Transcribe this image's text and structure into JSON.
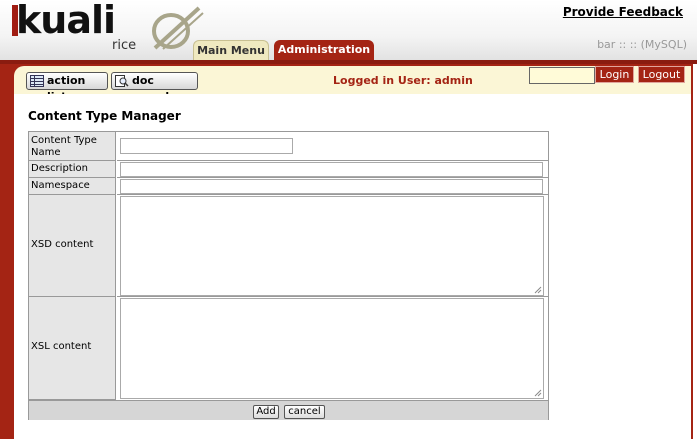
{
  "brand": {
    "name": "kuali",
    "sub": "rice"
  },
  "header": {
    "feedback": "Provide Feedback",
    "db_info": "bar :: :: (MySQL)"
  },
  "tabs": [
    {
      "label": "Main Menu",
      "active": false
    },
    {
      "label": "Administration",
      "active": true
    }
  ],
  "toolbar": {
    "action_list": "action list",
    "doc_search": "doc search"
  },
  "session": {
    "logged_in": "Logged in User: admin",
    "login_value": "",
    "login": "Login",
    "logout": "Logout"
  },
  "page": {
    "title": "Content Type Manager"
  },
  "form": {
    "content_type_name": {
      "label": "Content Type Name",
      "value": ""
    },
    "description": {
      "label": "Description",
      "value": ""
    },
    "namespace": {
      "label": "Namespace",
      "value": ""
    },
    "xsd": {
      "label": "XSD content",
      "value": ""
    },
    "xsl": {
      "label": "XSL content",
      "value": ""
    },
    "add": "Add",
    "cancel": "cancel"
  },
  "colors": {
    "brand_red": "#a42414",
    "toolbar_bg": "#fbf6d6",
    "main_tab": "#efe9c0"
  }
}
